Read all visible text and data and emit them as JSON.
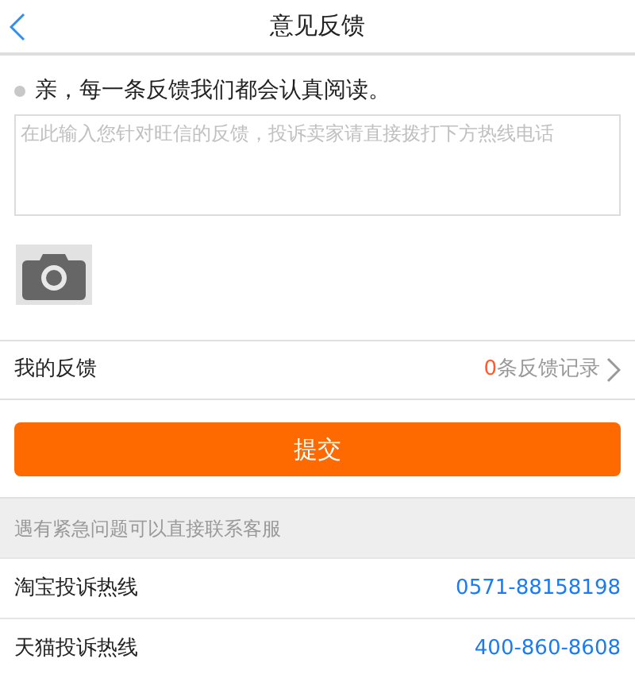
{
  "header": {
    "title": "意见反馈"
  },
  "hint": "亲，每一条反馈我们都会认真阅读。",
  "feedback_field": {
    "placeholder": "在此输入您针对旺信的反馈，投诉卖家请直接拨打下方热线电话"
  },
  "my_feedback": {
    "label": "我的反馈",
    "count": "0",
    "suffix": "条反馈记录"
  },
  "submit_button": "提交",
  "contact_section": {
    "title": "遇有紧急问题可以直接联系客服"
  },
  "hotlines": [
    {
      "label": "淘宝投诉热线",
      "number": "0571-88158198"
    },
    {
      "label": "天猫投诉热线",
      "number": "400-860-8608"
    }
  ]
}
